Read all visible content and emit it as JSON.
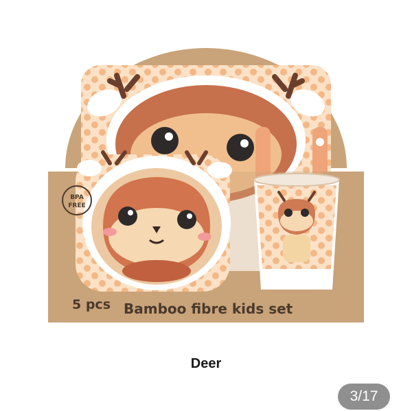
{
  "product": {
    "box_count_label": "5 pcs",
    "box_title": "Bamboo fibre kids set",
    "badge_line1": "BPA",
    "badge_line2": "FREE",
    "variant_caption": "Deer"
  },
  "gallery": {
    "page_indicator": "3/17"
  },
  "colors": {
    "cardboard": "#c9a47a",
    "plate_pink": "#e9a07c",
    "deer_brown": "#c7704c",
    "cream": "#f6d8b2",
    "dots": "#f0b27a"
  },
  "icons": [
    "deer-face-icon",
    "bpa-free-badge-icon"
  ]
}
